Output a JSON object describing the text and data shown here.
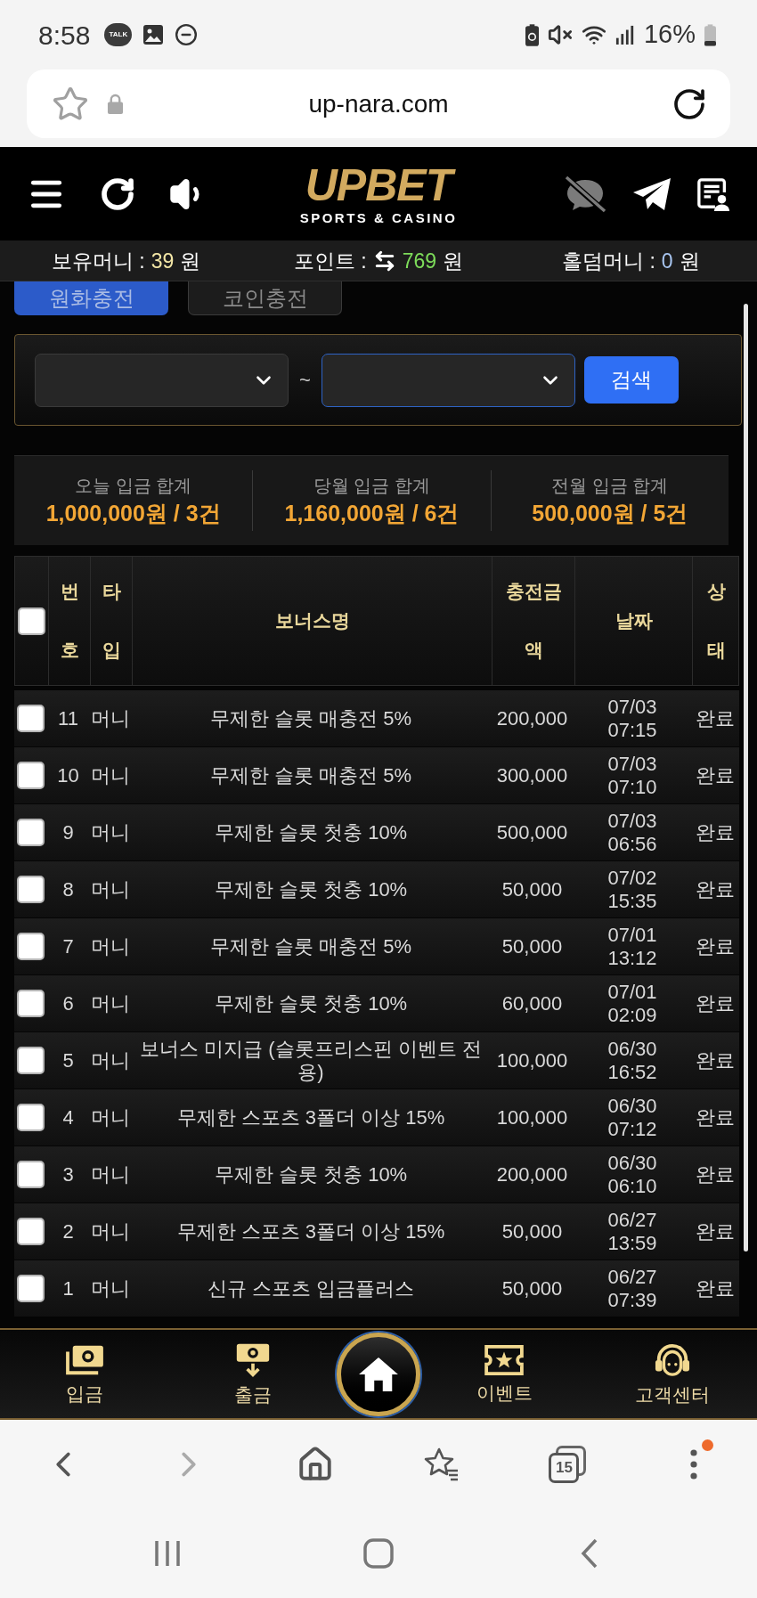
{
  "status_bar": {
    "time": "8:58",
    "chat_badge": "TALK",
    "battery": "16%"
  },
  "browser": {
    "url": "up-nara.com",
    "tab_count": "15",
    "menu_notification": true
  },
  "logo": {
    "wordmark": "UPBET",
    "tagline": "SPORTS & CASINO"
  },
  "balance": [
    {
      "label": "보유머니 :",
      "value": "39",
      "unit": "원",
      "color": "#f3e6a6",
      "kind": "plain"
    },
    {
      "label": "포인트 :",
      "value": "769",
      "unit": "원",
      "color": "#7ddc5a",
      "kind": "convertible"
    },
    {
      "label": "홀덤머니 :",
      "value": "0",
      "unit": "원",
      "color": "#a9c7f2",
      "kind": "plain"
    }
  ],
  "tabs": [
    {
      "label": "원화충전",
      "selected": true
    },
    {
      "label": "코인충전",
      "selected": false
    }
  ],
  "filter": {
    "date_selects": [
      {
        "focused": false
      },
      {
        "focused": true
      }
    ],
    "separator": "~",
    "button": "검색"
  },
  "summary": [
    {
      "label": "오늘 입금 합계",
      "value": "1,000,000원 / 3건"
    },
    {
      "label": "당월 입금 합계",
      "value": "1,160,000원 / 6건"
    },
    {
      "label": "전월 입금 합계",
      "value": "500,000원 / 5건"
    }
  ],
  "table": {
    "select_all": {
      "checked": false
    },
    "columns": [
      "번호",
      "타입",
      "보너스명",
      "충전금액",
      "날짜",
      "상태"
    ],
    "rows": [
      {
        "checked": false,
        "number": "11",
        "type": "머니",
        "bonus_name": "무제한 슬롯 매충전 5%",
        "amount": "200,000",
        "date": "07/03 07:15",
        "status": "완료"
      },
      {
        "checked": false,
        "number": "10",
        "type": "머니",
        "bonus_name": "무제한 슬롯 매충전 5%",
        "amount": "300,000",
        "date": "07/03 07:10",
        "status": "완료"
      },
      {
        "checked": false,
        "number": "9",
        "type": "머니",
        "bonus_name": "무제한 슬롯 첫충 10%",
        "amount": "500,000",
        "date": "07/03 06:56",
        "status": "완료"
      },
      {
        "checked": false,
        "number": "8",
        "type": "머니",
        "bonus_name": "무제한 슬롯 첫충 10%",
        "amount": "50,000",
        "date": "07/02 15:35",
        "status": "완료"
      },
      {
        "checked": false,
        "number": "7",
        "type": "머니",
        "bonus_name": "무제한 슬롯 매충전 5%",
        "amount": "50,000",
        "date": "07/01 13:12",
        "status": "완료"
      },
      {
        "checked": false,
        "number": "6",
        "type": "머니",
        "bonus_name": "무제한 슬롯 첫충 10%",
        "amount": "60,000",
        "date": "07/01 02:09",
        "status": "완료"
      },
      {
        "checked": false,
        "number": "5",
        "type": "머니",
        "bonus_name": "보너스 미지급 (슬롯프리스핀 이벤트 전용)",
        "amount": "100,000",
        "date": "06/30 16:52",
        "status": "완료"
      },
      {
        "checked": false,
        "number": "4",
        "type": "머니",
        "bonus_name": "무제한 스포츠 3폴더 이상 15%",
        "amount": "100,000",
        "date": "06/30 07:12",
        "status": "완료"
      },
      {
        "checked": false,
        "number": "3",
        "type": "머니",
        "bonus_name": "무제한 슬롯 첫충 10%",
        "amount": "200,000",
        "date": "06/30 06:10",
        "status": "완료"
      },
      {
        "checked": false,
        "number": "2",
        "type": "머니",
        "bonus_name": "무제한 스포츠 3폴더 이상 15%",
        "amount": "50,000",
        "date": "06/27 13:59",
        "status": "완료"
      },
      {
        "checked": false,
        "number": "1",
        "type": "머니",
        "bonus_name": "신규 스포츠 입금플러스",
        "amount": "50,000",
        "date": "06/27 07:39",
        "status": "완료"
      }
    ]
  },
  "bottom_nav": {
    "items": [
      {
        "label": "입금"
      },
      {
        "label": "출금"
      },
      {
        "label": "이벤트"
      },
      {
        "label": "고객센터"
      }
    ]
  }
}
